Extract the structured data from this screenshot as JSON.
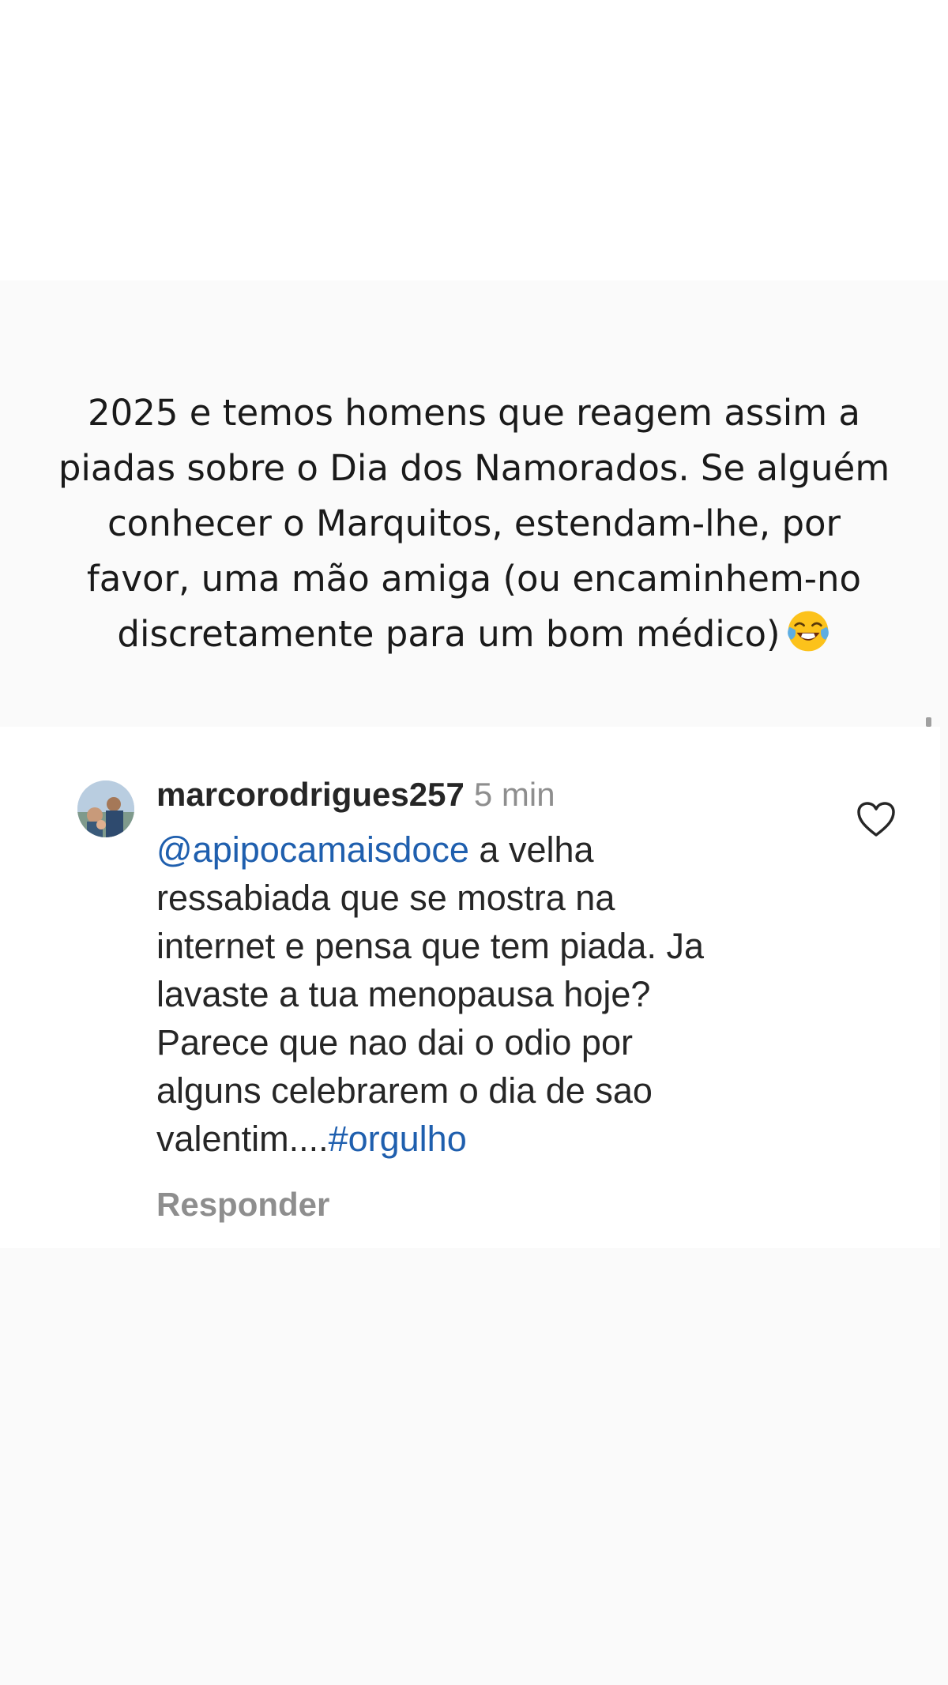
{
  "story": {
    "caption_lines": [
      "2025 e temos homens que reagem assim a",
      "piadas sobre o Dia dos Namorados. Se alguém",
      "conhecer o Marquitos, estendam-lhe, por",
      "favor, uma mão amiga  (ou encaminhem-no",
      "discretamente para um bom médico)"
    ],
    "caption_emoji": "face-with-tears-of-joy-icon"
  },
  "comment": {
    "username": "marcorodrigues257",
    "time": "5 min",
    "mention": "@apipocamaisdoce",
    "line1_rest": " a velha",
    "line2": "ressabiada que se mostra na",
    "line3": "internet e pensa que tem piada. Ja",
    "line4": "lavaste a tua menopausa hoje?",
    "line5": "Parece que nao dai o odio por",
    "line6": "alguns celebrarem o dia de sao",
    "line7_prefix": "valentim....",
    "hashtag": "#orgulho",
    "reply_label": "Responder"
  },
  "colors": {
    "link": "#1f5fae",
    "muted": "#8e8e8e",
    "text": "#262626"
  }
}
